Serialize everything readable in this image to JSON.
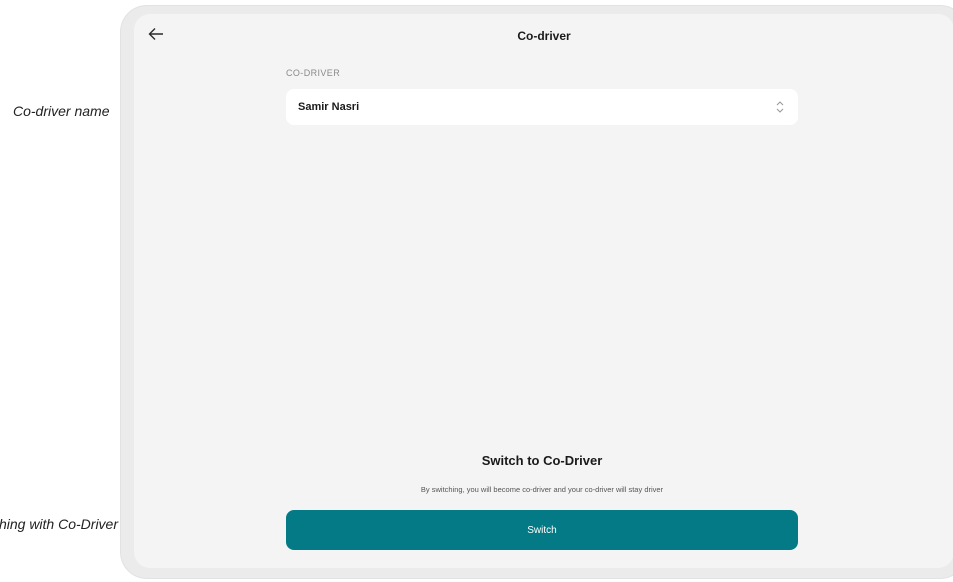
{
  "annotations": {
    "co_driver_name": "Co-driver name",
    "switching": "Switching with Co-Driver"
  },
  "header": {
    "back_icon": "arrow-left-icon",
    "title": "Co-driver"
  },
  "form": {
    "label": "CO-DRIVER",
    "selected_value": "Samir Nasri",
    "chevron_icon": "up-down-chevron-icon"
  },
  "switch_section": {
    "heading": "Switch to Co-Driver",
    "description": "By switching, you will become co-driver and your co-driver will stay driver",
    "button_label": "Switch"
  },
  "colors": {
    "accent": "#037a85",
    "annotation_arrow": "#d81f1f",
    "screen_bg": "#f4f4f4"
  }
}
